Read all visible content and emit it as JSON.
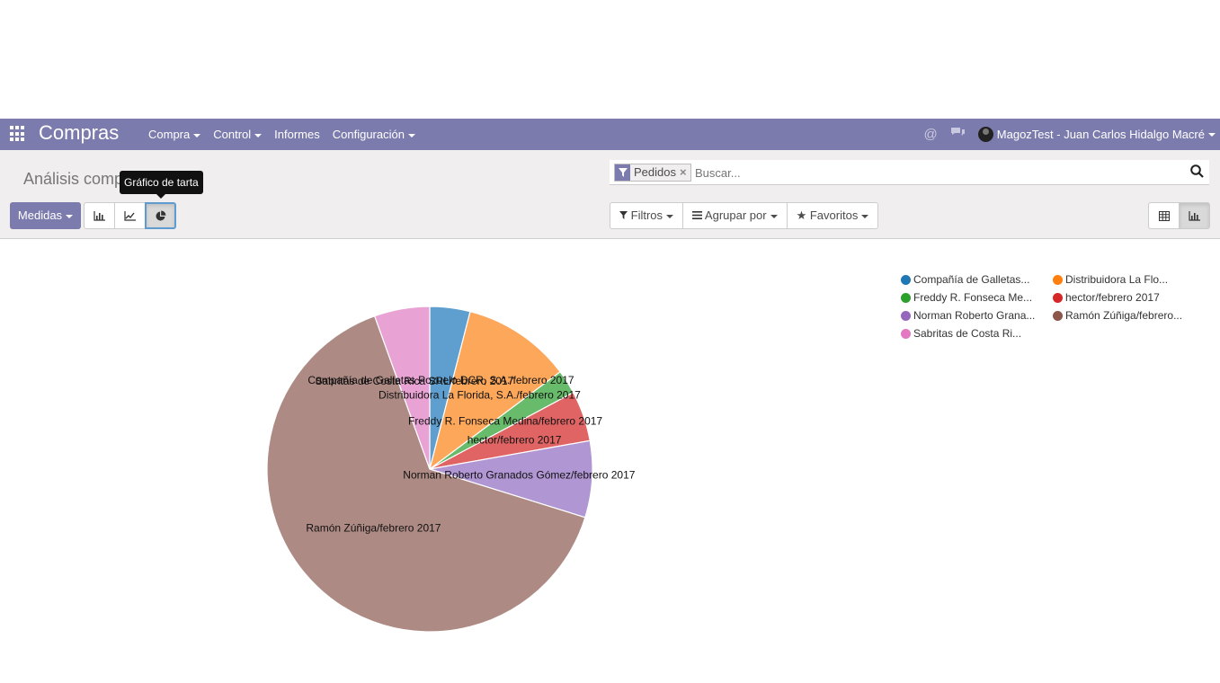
{
  "app": {
    "title": "Compras"
  },
  "menu": [
    {
      "label": "Compra",
      "dropdown": true
    },
    {
      "label": "Control",
      "dropdown": true
    },
    {
      "label": "Informes",
      "dropdown": false
    },
    {
      "label": "Configuración",
      "dropdown": true
    }
  ],
  "user": {
    "name": "MagozTest - Juan Carlos Hidalgo Macré"
  },
  "breadcrumb": "Análisis comp",
  "tooltip": "Gráfico de tarta",
  "measures_label": "Medidas",
  "search": {
    "facet": "Pedidos",
    "facet_remove": "×",
    "placeholder": "Buscar..."
  },
  "filters": {
    "filters": "Filtros",
    "group_by": "Agrupar por",
    "favorites": "Favoritos"
  },
  "colors": {
    "navbar": "#7c7bad",
    "accent": "#7c7bad"
  },
  "chart_data": {
    "type": "pie",
    "labels": [
      "Compañía de Galletas Pozuelo DCR, S.A./febrero 2017",
      "Distribuidora La Florida, S.A./febrero 2017",
      "Freddy R. Fonseca Medina/febrero 2017",
      "hector/febrero 2017",
      "Norman Roberto Granados Gómez/febrero 2017",
      "Ramón Zúñiga/febrero 2017",
      "Sabritas de Costa Rica SRL/febrero 2017"
    ],
    "values": [
      4.0,
      10.8,
      2.4,
      5.0,
      7.6,
      64.7,
      5.5
    ],
    "colors": [
      "#5f9fcf",
      "#fca75a",
      "#68bb6a",
      "#e06464",
      "#b196d4",
      "#ad8a83",
      "#e9a2d4"
    ],
    "legend": [
      "Compañía de Galletas...",
      "Distribuidora La Flo...",
      "Freddy R. Fonseca Me...",
      "hector/febrero 2017",
      "Norman Roberto Grana...",
      "Ramón Zúñiga/febrero...",
      "Sabritas de Costa Ri..."
    ],
    "legend_dot_colors": [
      "#1f77b4",
      "#ff7f0e",
      "#2ca02c",
      "#d62728",
      "#9467bd",
      "#8c564b",
      "#e377c2"
    ],
    "legend_position": "top-right"
  }
}
